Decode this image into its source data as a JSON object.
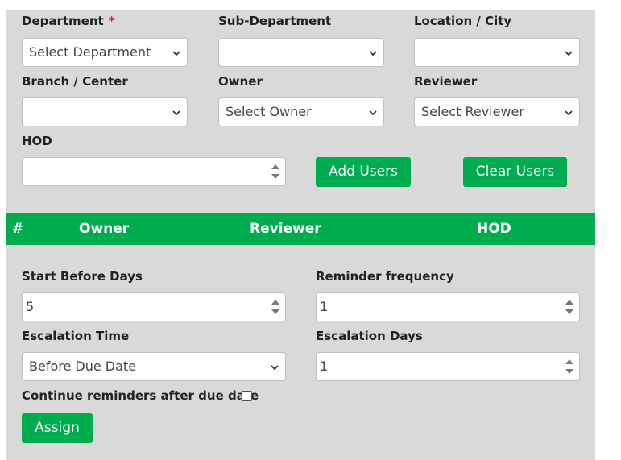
{
  "filters": {
    "department": {
      "label": "Department",
      "required_mark": "*",
      "value": "Select Department"
    },
    "sub_department": {
      "label": "Sub-Department",
      "value": ""
    },
    "location": {
      "label": "Location / City",
      "value": ""
    },
    "branch": {
      "label": "Branch / Center",
      "value": ""
    },
    "owner": {
      "label": "Owner",
      "value": "Select Owner"
    },
    "reviewer": {
      "label": "Reviewer",
      "value": "Select Reviewer"
    },
    "hod": {
      "label": "HOD",
      "value": ""
    }
  },
  "buttons": {
    "add_users": "Add Users",
    "clear_users": "Clear Users",
    "assign": "Assign"
  },
  "table": {
    "columns": [
      "#",
      "Owner",
      "Reviewer",
      "HOD"
    ],
    "rows": []
  },
  "reminders": {
    "start_before_days": {
      "label": "Start Before Days",
      "value": "5"
    },
    "reminder_frequency": {
      "label": "Reminder frequency",
      "value": "1"
    },
    "escalation_time": {
      "label": "Escalation Time",
      "value": "Before Due Date"
    },
    "escalation_days": {
      "label": "Escalation Days",
      "value": "1"
    },
    "continue_after_due": {
      "label": "Continue reminders after due date",
      "checked": false
    }
  },
  "colors": {
    "accent": "#00ad4e",
    "panel": "#d9d9d9",
    "required": "#e02020"
  }
}
